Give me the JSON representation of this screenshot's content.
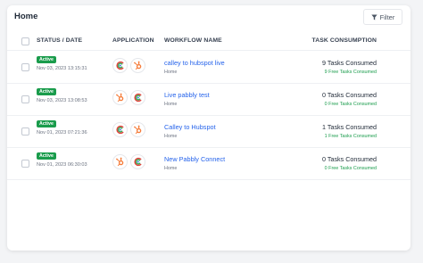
{
  "header": {
    "title": "Home",
    "filter_label": "Filter"
  },
  "columns": {
    "status_date": "STATUS / DATE",
    "application": "APPLICATION",
    "workflow_name": "WORKFLOW NAME",
    "task_consumption": "TASK CONSUMPTION"
  },
  "rows": [
    {
      "status": "Active",
      "date": "Nov 03, 2023 13:15:31",
      "apps": [
        "calley-icon",
        "hubspot-icon"
      ],
      "name": "calley to hubspot live",
      "folder": "Home",
      "tasks": "9 Tasks Consumed",
      "free": "9 Free Tasks Consumed"
    },
    {
      "status": "Active",
      "date": "Nov 03, 2023 13:08:53",
      "apps": [
        "hubspot-icon",
        "calley-icon"
      ],
      "name": "Live pabbly test",
      "folder": "Home",
      "tasks": "0 Tasks Consumed",
      "free": "0 Free Tasks Consumed"
    },
    {
      "status": "Active",
      "date": "Nov 01, 2023 07:21:36",
      "apps": [
        "calley-icon",
        "hubspot-icon"
      ],
      "name": "Calley to Hubspot",
      "folder": "Home",
      "tasks": "1 Tasks Consumed",
      "free": "1 Free Tasks Consumed"
    },
    {
      "status": "Active",
      "date": "Nov 01, 2023 06:30:03",
      "apps": [
        "hubspot-icon",
        "calley-icon"
      ],
      "name": "New Pabbly Connect",
      "folder": "Home",
      "tasks": "0 Tasks Consumed",
      "free": "0 Free Tasks Consumed"
    }
  ],
  "colors": {
    "active_badge": "#1a9c4c",
    "link": "#2563eb",
    "free_tasks": "#1a9c4c",
    "hubspot": "#f57c3a",
    "calley_red": "#e0413a",
    "calley_green": "#32a852",
    "calley_blue": "#2e6fe0"
  }
}
